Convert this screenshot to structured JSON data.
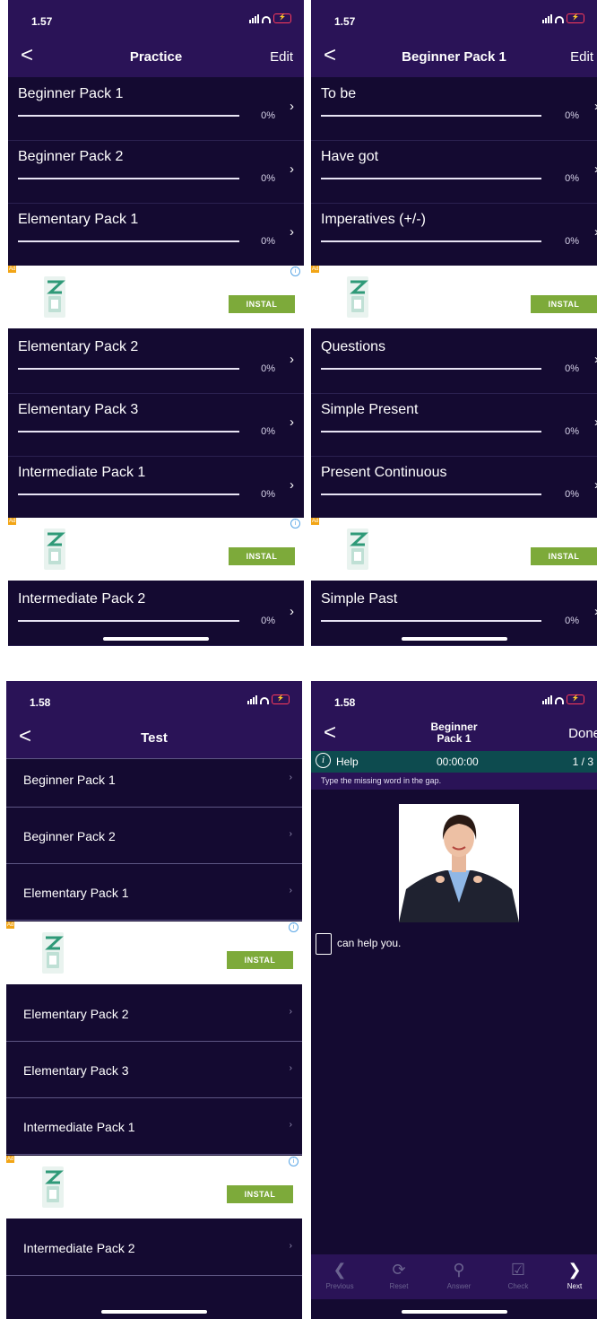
{
  "status": {
    "time_top": "1.57",
    "time_bottom": "1.58"
  },
  "colors": {
    "background": "#140a31",
    "navbar": "#2a1357",
    "help_bar": "#0d4b4f",
    "install_button": "#7daa3a",
    "ad_badge": "#f2a516"
  },
  "practice": {
    "back": "<",
    "title": "Practice",
    "edit": "Edit",
    "items": [
      {
        "label": "Beginner Pack 1",
        "pct": "0%",
        "progress": 0
      },
      {
        "label": "Beginner Pack 2",
        "pct": "0%",
        "progress": 0
      },
      {
        "label": "Elementary Pack 1",
        "pct": "0%",
        "progress": 0
      },
      {
        "label": "Elementary Pack 2",
        "pct": "0%",
        "progress": 0
      },
      {
        "label": "Elementary Pack 3",
        "pct": "0%",
        "progress": 0
      },
      {
        "label": "Intermediate Pack 1",
        "pct": "0%",
        "progress": 0
      },
      {
        "label": "Intermediate Pack 2",
        "pct": "0%",
        "progress": 0
      }
    ]
  },
  "pack": {
    "back": "<",
    "title": "Beginner Pack 1",
    "edit": "Edit",
    "items": [
      {
        "label": "To be",
        "pct": "0%",
        "progress": 0
      },
      {
        "label": "Have got",
        "pct": "0%",
        "progress": 0
      },
      {
        "label": "Imperatives (+/-)",
        "pct": "0%",
        "progress": 0
      },
      {
        "label": "Questions",
        "pct": "0%",
        "progress": 0
      },
      {
        "label": "Simple Present",
        "pct": "0%",
        "progress": 0
      },
      {
        "label": "Present Continuous",
        "pct": "0%",
        "progress": 0
      },
      {
        "label": "Simple Past",
        "pct": "0%",
        "progress": 0
      }
    ]
  },
  "ad": {
    "badge": "Ad",
    "info": "i",
    "install": "INSTAL"
  },
  "test": {
    "back": "<",
    "title": "Test",
    "items": [
      "Beginner Pack 1",
      "Beginner Pack 2",
      "Elementary Pack 1",
      "Elementary Pack 2",
      "Elementary Pack 3",
      "Intermediate Pack 1",
      "Intermediate Pack 2"
    ]
  },
  "exercise": {
    "back": "<",
    "title_line1": "Beginner",
    "title_line2": "Pack 1",
    "done": "Done",
    "help": "Help",
    "timer": "00:00:00",
    "counter": "1 / 3",
    "instruction": "Type the missing word in the gap.",
    "sentence": "can help you.",
    "toolbar": {
      "previous": "Previous",
      "reset": "Reset",
      "answer": "Answer",
      "check": "Check",
      "next": "Next"
    }
  },
  "icons": [
    "chevron-left-icon",
    "chevron-right-icon",
    "signal-icon",
    "wifi-icon",
    "battery-icon",
    "info-icon",
    "help-icon",
    "reset-icon",
    "key-icon",
    "check-icon",
    "app-icon"
  ]
}
